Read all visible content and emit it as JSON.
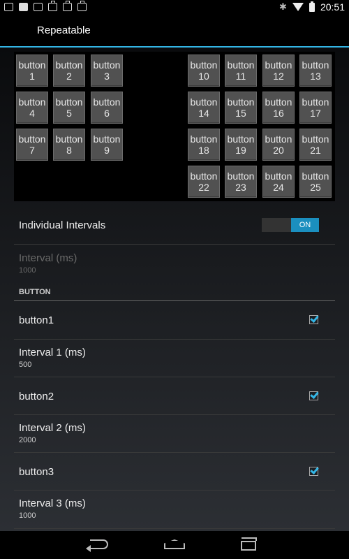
{
  "status_bar": {
    "time": "20:51",
    "icons": [
      "image-icon",
      "mail-icon",
      "news-icon",
      "bag-icon",
      "bag-icon",
      "bag-icon"
    ],
    "right_icons": [
      "bluetooth-icon",
      "wifi-icon",
      "battery-icon"
    ]
  },
  "action_bar": {
    "title": "Repeatable"
  },
  "buttons_left": [
    {
      "line1": "button",
      "line2": "1"
    },
    {
      "line1": "button",
      "line2": "2"
    },
    {
      "line1": "button",
      "line2": "3"
    },
    {
      "line1": "button",
      "line2": "4"
    },
    {
      "line1": "button",
      "line2": "5"
    },
    {
      "line1": "button",
      "line2": "6"
    },
    {
      "line1": "button",
      "line2": "7"
    },
    {
      "line1": "button",
      "line2": "8"
    },
    {
      "line1": "button",
      "line2": "9"
    }
  ],
  "buttons_right": [
    {
      "line1": "button",
      "line2": "10"
    },
    {
      "line1": "button",
      "line2": "11"
    },
    {
      "line1": "button",
      "line2": "12"
    },
    {
      "line1": "button",
      "line2": "13"
    },
    {
      "line1": "button",
      "line2": "14"
    },
    {
      "line1": "button",
      "line2": "15"
    },
    {
      "line1": "button",
      "line2": "16"
    },
    {
      "line1": "button",
      "line2": "17"
    },
    {
      "line1": "button",
      "line2": "18"
    },
    {
      "line1": "button",
      "line2": "19"
    },
    {
      "line1": "button",
      "line2": "20"
    },
    {
      "line1": "button",
      "line2": "21"
    },
    {
      "line1": "button",
      "line2": "22"
    },
    {
      "line1": "button",
      "line2": "23"
    },
    {
      "line1": "button",
      "line2": "24"
    },
    {
      "line1": "button",
      "line2": "25"
    }
  ],
  "individual_intervals": {
    "label": "Individual Intervals",
    "toggle_state": "ON"
  },
  "global_interval": {
    "title": "Interval  (ms)",
    "value": "1000",
    "enabled": false
  },
  "category": {
    "label": "BUTTON"
  },
  "button_prefs": [
    {
      "name": "button1",
      "checked": true,
      "interval_title": "Interval 1  (ms)",
      "interval_value": "500"
    },
    {
      "name": "button2",
      "checked": true,
      "interval_title": "Interval 2  (ms)",
      "interval_value": "2000"
    },
    {
      "name": "button3",
      "checked": true,
      "interval_title": "Interval 3  (ms)",
      "interval_value": "1000"
    }
  ],
  "colors": {
    "accent": "#33b5e5",
    "toggle_on": "#1b8fbf",
    "button_bg": "#515151"
  }
}
